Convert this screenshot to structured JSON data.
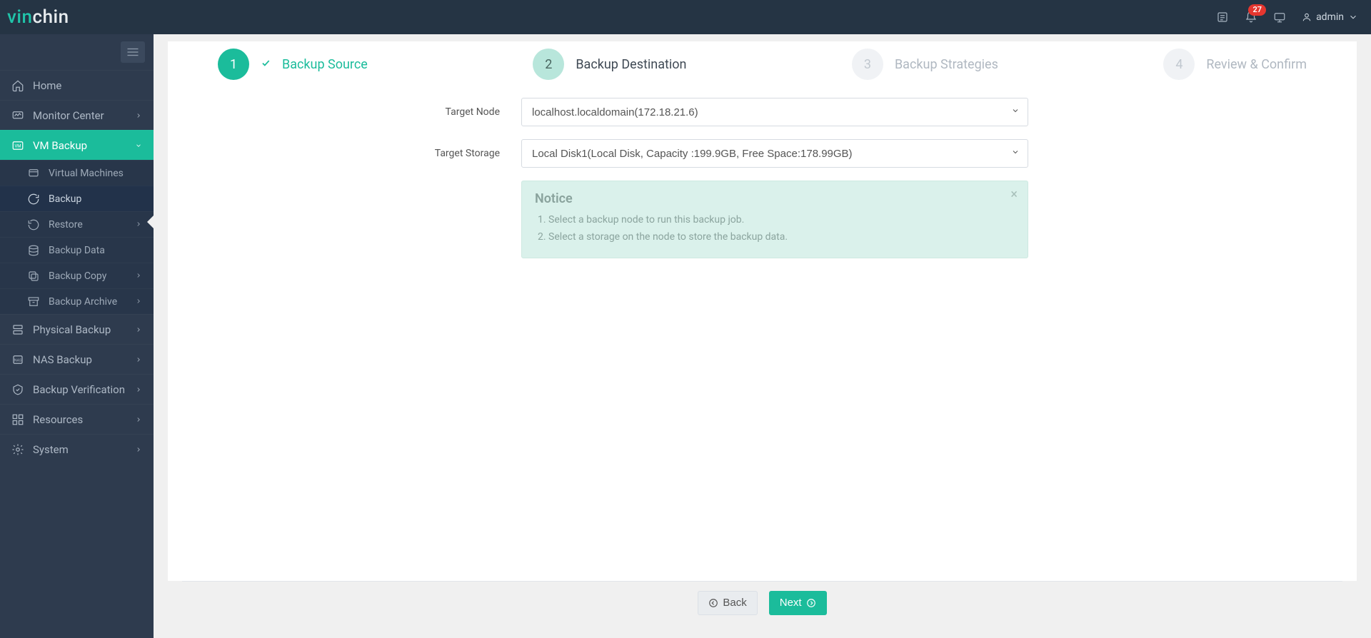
{
  "brand": {
    "pre": "vin",
    "post": "chin"
  },
  "topbar": {
    "notification_count": "27",
    "user_label": "admin"
  },
  "sidebar": {
    "items": [
      {
        "key": "home",
        "label": "Home",
        "expandable": false
      },
      {
        "key": "monitor-center",
        "label": "Monitor Center",
        "expandable": true
      },
      {
        "key": "vm-backup",
        "label": "VM Backup",
        "expandable": true,
        "active": true,
        "children": [
          {
            "key": "virtual-machines",
            "label": "Virtual Machines",
            "expandable": false
          },
          {
            "key": "backup",
            "label": "Backup",
            "expandable": false,
            "selected": true
          },
          {
            "key": "restore",
            "label": "Restore",
            "expandable": true
          },
          {
            "key": "backup-data",
            "label": "Backup Data",
            "expandable": false
          },
          {
            "key": "backup-copy",
            "label": "Backup Copy",
            "expandable": true
          },
          {
            "key": "backup-archive",
            "label": "Backup Archive",
            "expandable": true
          }
        ]
      },
      {
        "key": "physical-backup",
        "label": "Physical Backup",
        "expandable": true
      },
      {
        "key": "nas-backup",
        "label": "NAS Backup",
        "expandable": true
      },
      {
        "key": "backup-verification",
        "label": "Backup Verification",
        "expandable": true
      },
      {
        "key": "resources",
        "label": "Resources",
        "expandable": true
      },
      {
        "key": "system",
        "label": "System",
        "expandable": true
      }
    ]
  },
  "wizard": {
    "steps": [
      {
        "num": "1",
        "label": "Backup Source",
        "state": "done"
      },
      {
        "num": "2",
        "label": "Backup Destination",
        "state": "active"
      },
      {
        "num": "3",
        "label": "Backup Strategies",
        "state": "disabled"
      },
      {
        "num": "4",
        "label": "Review & Confirm",
        "state": "disabled"
      }
    ]
  },
  "form": {
    "target_node": {
      "label": "Target Node",
      "value": "localhost.localdomain(172.18.21.6)"
    },
    "target_storage": {
      "label": "Target Storage",
      "value": "Local Disk1(Local Disk, Capacity :199.9GB, Free Space:178.99GB)"
    }
  },
  "notice": {
    "title": "Notice",
    "lines": [
      "Select a backup node to run this backup job.",
      "Select a storage on the node to store the backup data."
    ]
  },
  "footer": {
    "back": "Back",
    "next": "Next"
  }
}
